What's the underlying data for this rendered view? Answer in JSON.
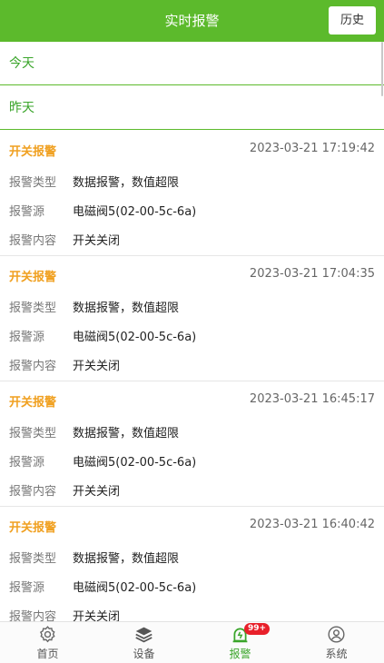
{
  "header": {
    "title": "实时报警",
    "history_label": "历史"
  },
  "sections": {
    "today": "今天",
    "yesterday": "昨天"
  },
  "field_labels": {
    "type": "报警类型",
    "source": "报警源",
    "content": "报警内容"
  },
  "alarms": [
    {
      "title": "开关报警",
      "time": "2023-03-21 17:19:42",
      "type": "数据报警，数值超限",
      "source": "电磁阀5(02-00-5c-6a)",
      "content": "开关关闭"
    },
    {
      "title": "开关报警",
      "time": "2023-03-21 17:04:35",
      "type": "数据报警，数值超限",
      "source": "电磁阀5(02-00-5c-6a)",
      "content": "开关关闭"
    },
    {
      "title": "开关报警",
      "time": "2023-03-21 16:45:17",
      "type": "数据报警，数值超限",
      "source": "电磁阀5(02-00-5c-6a)",
      "content": "开关关闭"
    },
    {
      "title": "开关报警",
      "time": "2023-03-21 16:40:42",
      "type": "数据报警，数值超限",
      "source": "电磁阀5(02-00-5c-6a)",
      "content": "开关关闭"
    }
  ],
  "tabs": [
    {
      "label": "首页",
      "icon": "gear-icon"
    },
    {
      "label": "设备",
      "icon": "layers-icon"
    },
    {
      "label": "报警",
      "icon": "alarm-icon",
      "badge": "99+"
    },
    {
      "label": "系统",
      "icon": "user-icon"
    }
  ],
  "colors": {
    "accent": "#5cba2c",
    "alarm_title": "#f0a020",
    "badge": "#e8202a"
  }
}
